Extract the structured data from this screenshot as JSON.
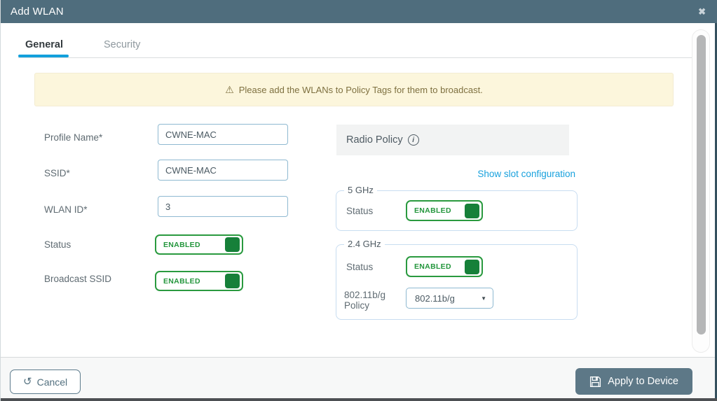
{
  "dialog": {
    "title": "Add WLAN"
  },
  "icons": {
    "close": "✖",
    "warning": "⚠",
    "undo": "↺",
    "caret": "▼",
    "info": "i"
  },
  "tabs": {
    "general": "General",
    "security": "Security"
  },
  "warning": {
    "text": "Please add the WLANs to Policy Tags for them to broadcast."
  },
  "form": {
    "profile_name": {
      "label": "Profile Name*",
      "value": "CWNE-MAC"
    },
    "ssid": {
      "label": "SSID*",
      "value": "CWNE-MAC"
    },
    "wlan_id": {
      "label": "WLAN ID*",
      "value": "3"
    },
    "status": {
      "label": "Status",
      "state": "ENABLED"
    },
    "broadcast_ssid": {
      "label": "Broadcast SSID",
      "state": "ENABLED"
    }
  },
  "radio_policy": {
    "header": "Radio Policy",
    "link": "Show slot configuration",
    "band_5ghz": {
      "legend": "5 GHz",
      "status_label": "Status",
      "state": "ENABLED"
    },
    "band_24ghz": {
      "legend": "2.4 GHz",
      "status_label": "Status",
      "state": "ENABLED",
      "policy_label": "802.11b/g Policy",
      "policy_value": "802.11b/g"
    }
  },
  "footer": {
    "cancel": "Cancel",
    "apply": "Apply to Device"
  },
  "colors": {
    "titlebar": "#4f6d7d",
    "accent_blue": "#12a0dc",
    "link_blue": "#18a1dd",
    "success_green": "#2a9a3f",
    "knob_green": "#168039",
    "warning_bg": "#fcf6dc",
    "warning_text": "#7e7040",
    "apply_button_bg": "#5d7887",
    "fieldset_border": "#c8ddf1",
    "input_border": "#8fb9d1"
  }
}
